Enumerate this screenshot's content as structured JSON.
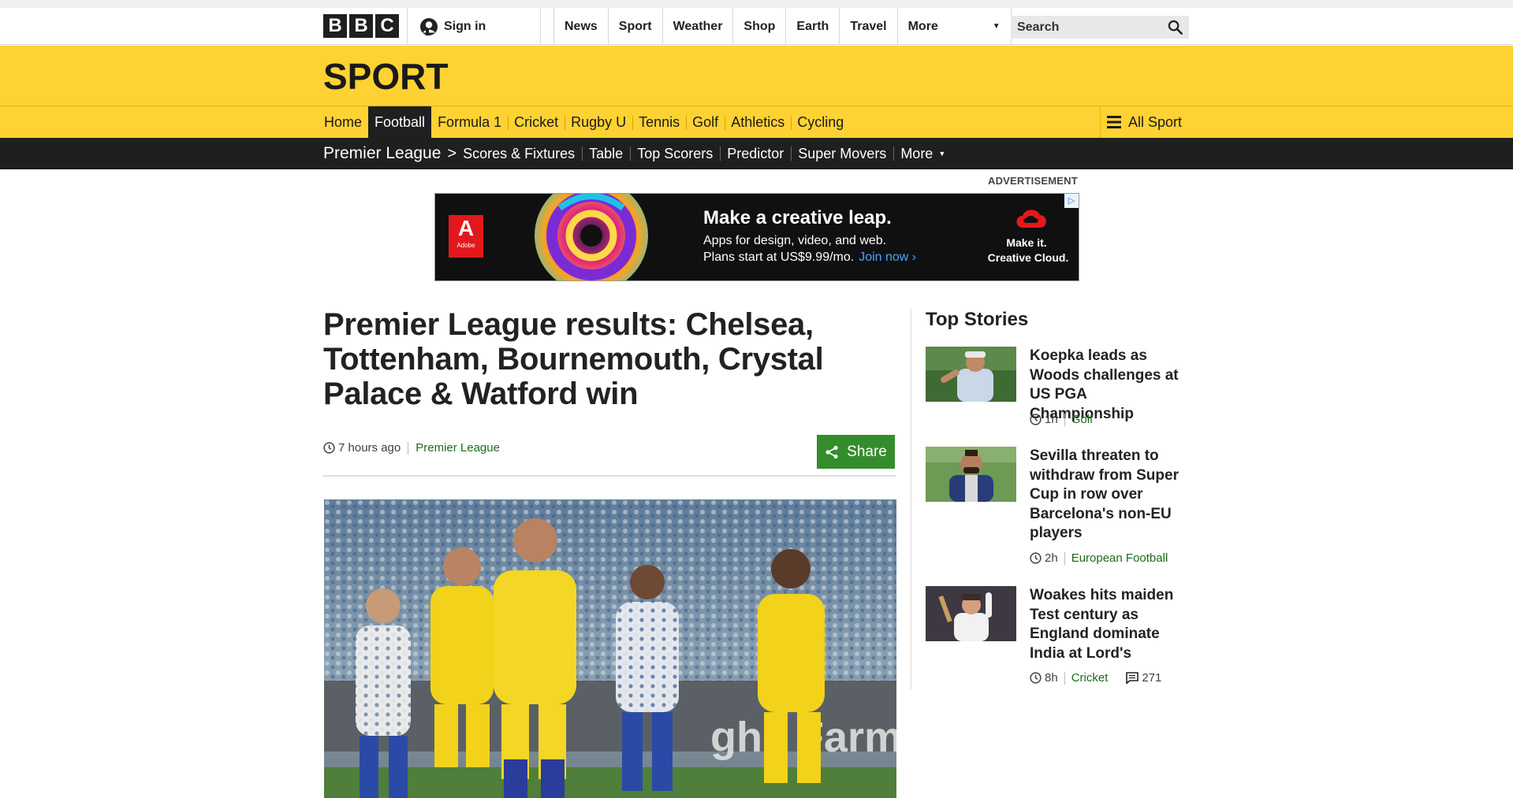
{
  "global_nav": {
    "logo_letters": [
      "B",
      "B",
      "C"
    ],
    "signin_label": "Sign in",
    "items": [
      "News",
      "Sport",
      "Weather",
      "Shop",
      "Earth",
      "Travel"
    ],
    "more_label": "More",
    "search_placeholder": "Search"
  },
  "sport_header": {
    "wordmark": "SPORT",
    "nav": [
      "Home",
      "Football",
      "Formula 1",
      "Cricket",
      "Rugby U",
      "Tennis",
      "Golf",
      "Athletics",
      "Cycling"
    ],
    "active_item": "Football",
    "all_sport_label": "All Sport"
  },
  "sub_nav": {
    "section": "Premier League",
    "items": [
      "Scores & Fixtures",
      "Table",
      "Top Scorers",
      "Predictor",
      "Super Movers"
    ],
    "more_label": "More"
  },
  "advertisement": {
    "label": "ADVERTISEMENT",
    "brand": "Adobe",
    "headline": "Make a creative leap.",
    "copy_line1": "Apps for design, video, and web.",
    "copy_line2": "Plans start at US$9.99/mo.",
    "cta": "Join now ›",
    "tagline1": "Make it.",
    "tagline2": "Creative Cloud."
  },
  "article": {
    "headline": "Premier League results: Chelsea, Tottenham, Bournemouth, Crystal Palace & Watford win",
    "timestamp": "7 hours ago",
    "section": "Premier League",
    "share_label": "Share"
  },
  "top_stories": {
    "title": "Top Stories",
    "items": [
      {
        "title": "Koepka leads as Woods challenges at US PGA Championship",
        "time": "1h",
        "tag": "Golf"
      },
      {
        "title": "Sevilla threaten to withdraw from Super Cup in row over Barcelona's non-EU players",
        "time": "2h",
        "tag": "European Football"
      },
      {
        "title": "Woakes hits maiden Test century as England dominate India at Lord's",
        "time": "8h",
        "tag": "Cricket",
        "comments": "271"
      }
    ]
  },
  "colors": {
    "sport_yellow": "#fed233",
    "nav_dark": "#1f1f1f",
    "link_green": "#1a6b1a",
    "share_green": "#348d2d"
  }
}
